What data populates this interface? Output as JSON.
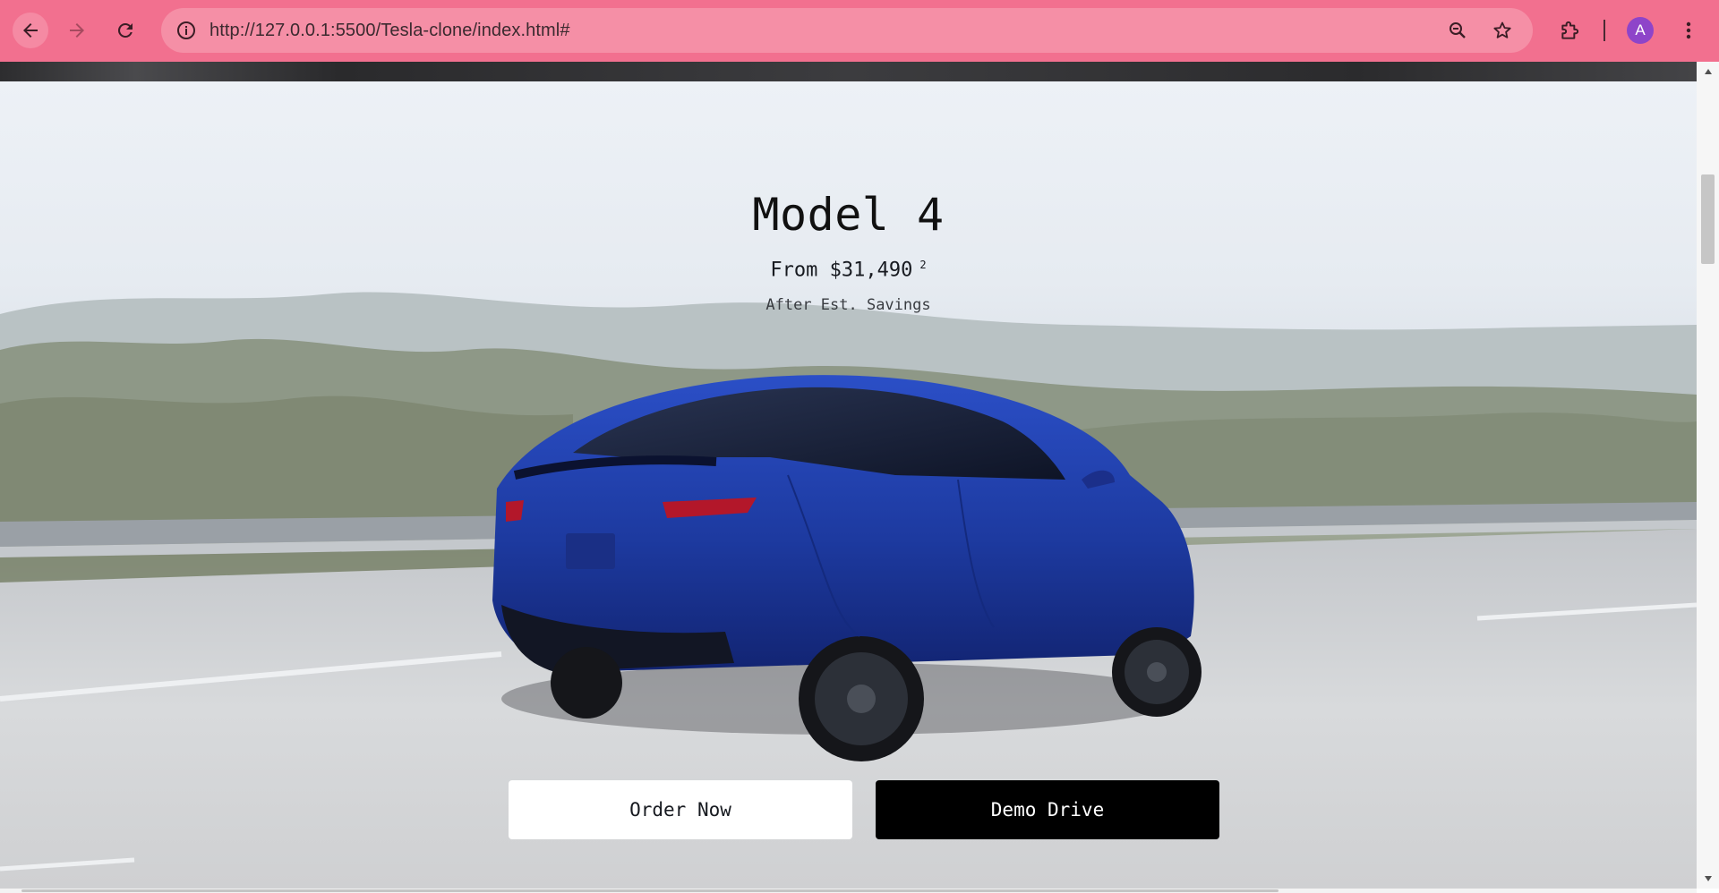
{
  "browser": {
    "url": "http://127.0.0.1:5500/Tesla-clone/index.html#",
    "profile_initial": "A",
    "chrome_color": "#f2708f",
    "icons": {
      "back": "back-arrow-icon",
      "forward": "forward-arrow-icon",
      "reload": "reload-icon",
      "site_info": "info-icon",
      "zoom": "zoom-icon",
      "bookmark": "star-icon",
      "extensions": "puzzle-icon",
      "menu": "kebab-menu-icon"
    }
  },
  "hero": {
    "title": "Model 4",
    "price": "From $31,490",
    "price_footnote": "2",
    "subtitle": "After Est. Savings",
    "buttons": {
      "order": "Order Now",
      "demo": "Demo Drive"
    },
    "colors": {
      "order_bg": "#ffffff",
      "demo_bg": "#000000",
      "car": "#1f3fa8"
    }
  }
}
